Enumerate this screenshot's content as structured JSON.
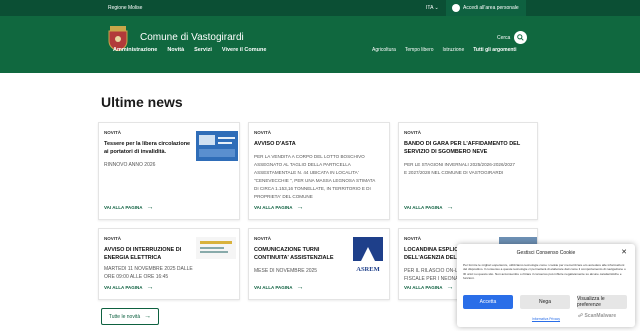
{
  "topbar": {
    "region": "Regione Molise",
    "lang": "ITA",
    "login": "Accedi all'area personale"
  },
  "header": {
    "title": "Comune di Vastogirardi",
    "search_label": "Cerca"
  },
  "nav_main": [
    "Amministrazione",
    "Novità",
    "Servizi",
    "Vivere il Comune"
  ],
  "nav_topics": [
    "Agricoltura",
    "Tempo libero",
    "Istruzione",
    "Tutti gli argomenti"
  ],
  "section_title": "Ultime news",
  "cards": [
    {
      "tag": "NOVITÀ",
      "title_lines": [
        "Tessere per la libera circolazione",
        "ai portatori di invalidità."
      ],
      "desc_lines": [
        "RINNOVO ANNO 2026"
      ],
      "link": "VAI ALLA PAGINA"
    },
    {
      "tag": "NOVITÀ",
      "title_lines": [
        "AVVISO D'ASTA"
      ],
      "desc_lines": [
        "PER LA VENDITA A CORPO DEL LOTTO BOSCHIVO",
        "ASSEGNATO AL TAGLIO DELLA PARTICELLA",
        "ASSESTAMENTALE N. 44 UBICATA IN LOCALITA'",
        "\"CENEVECCHIE \", PER UNA MASSA LEGNOSA STIMATA",
        "DI CIRCA 1.153,16 TONNELLATE, IN TERRITORIO E DI",
        "PROPRIETA' DEL COMUNE"
      ],
      "link": "VAI ALLA PAGINA"
    },
    {
      "tag": "NOVITÀ",
      "title_lines": [
        "BANDO DI GARA PER L'AFFIDAMENTO DEL",
        "SERVIZIO DI SGOMBERO NEVE"
      ],
      "desc_lines": [
        "PER LE STAGIONI INVERNALI 2025/2026-2026/2027",
        "E 2027/2028 NEL COMUNE DI VASTOGIRARDI"
      ],
      "link": "VAI ALLA PAGINA"
    },
    {
      "tag": "NOVITÀ",
      "title_lines": [
        "AVVISO DI INTERRUZIONE DI",
        "ENERGIA ELETTRICA"
      ],
      "desc_lines": [
        "MARTEDI 11 NOVEMBRE 2025 DALLE",
        "ORE 09:00 ALLE ORE 16:45"
      ],
      "link": "VAI ALLA PAGINA"
    },
    {
      "tag": "NOVITÀ",
      "title_lines": [
        "COMUNICAZIONE TURNI",
        "CONTINUITA' ASSISTENZIALE"
      ],
      "desc_lines": [
        "MESE DI NOVEMBRE 2025"
      ],
      "link": "VAI ALLA PAGINA",
      "logo_text": "ASREM"
    },
    {
      "tag": "NOVITÀ",
      "title_lines": [
        "LOCANDINA ESPLICA",
        "DELL'AGENZIA DELLE"
      ],
      "desc_lines": [
        "PER IL RILASCIO ON-LIN",
        "FISCALE PER I NEONAT"
      ],
      "link": "VAI ALLA PAGINA"
    }
  ],
  "more_button": "Tutte le novità",
  "consent": {
    "title": "Gestisci Consenso Cookie",
    "text": "Per fornire le migliori esperienze, utilizziamo tecnologie come i cookie per memorizzare e/o accedere alle informazioni del dispositivo. Il consenso a queste tecnologie ci permetterà di elaborare dati come il comportamento di navigazione o ID unici su questo sito. Non acconsentire o ritirare il consenso può influire negativamente su alcune caratteristiche e funzioni.",
    "accept": "Accetta",
    "deny": "Nega",
    "prefs": "Visualizza le preferenze",
    "policy": "Informativa Privacy"
  },
  "badge": "ScanMalware",
  "colors": {
    "primary": "#10683f",
    "dark": "#0b4f34",
    "accent_blue": "#2a6ee8"
  }
}
